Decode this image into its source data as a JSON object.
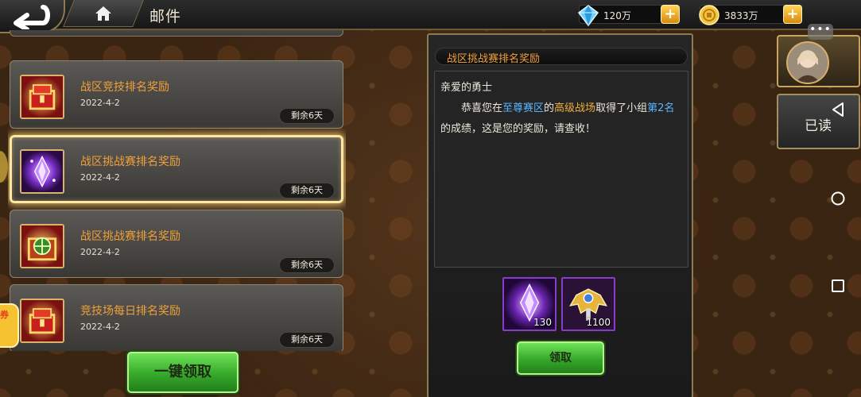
{
  "header": {
    "title": "邮件",
    "diamonds": "120万",
    "gold": "3833万"
  },
  "mails": [
    {
      "title": "战区竞技排名奖励",
      "date": "2022-4-2",
      "remain": "剩余6天",
      "icon": "red-gold-chest-icon"
    },
    {
      "title": "战区挑战赛排名奖励",
      "date": "2022-4-2",
      "remain": "剩余6天",
      "icon": "purple-crystal-icon",
      "selected": true
    },
    {
      "title": "战区挑战赛排名奖励",
      "date": "2022-4-2",
      "remain": "剩余6天",
      "icon": "green-target-chest-icon"
    },
    {
      "title": "竞技场每日排名奖励",
      "date": "2022-4-2",
      "remain": "剩余6天",
      "icon": "red-gold-chest-icon"
    }
  ],
  "detail": {
    "title": "战区挑战赛排名奖励",
    "greeting": "亲爱的勇士",
    "body": {
      "part1": "恭喜您在",
      "zone": "至尊赛区",
      "part2": "的",
      "arena": "高级战场",
      "part3": "取得了小组",
      "rank": "第2名",
      "part4": "的成绩，这是您的奖励，请查收！"
    },
    "rewards": [
      {
        "icon": "purple-crystal-icon",
        "count": "130"
      },
      {
        "icon": "golden-winged-emblem-icon",
        "count": "1100"
      }
    ],
    "claim_label": "领取"
  },
  "actions": {
    "claim_all_label": "一键领取",
    "read_label": "已读",
    "more": "•••"
  },
  "side": {
    "coupon_label": "券"
  },
  "colors": {
    "mail_title": "#f0a03a",
    "highlight_blue": "#5ab6ff",
    "highlight_gold": "#f0b13a",
    "button_green": "#36a82a",
    "frame_gold": "#8d7b55"
  }
}
